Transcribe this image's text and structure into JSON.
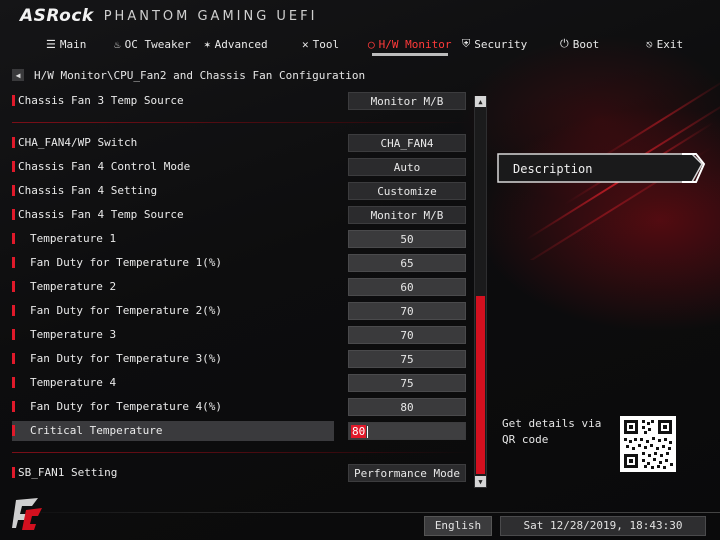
{
  "brand": {
    "name": "ASRock",
    "product": "PHANTOM GAMING UEFI"
  },
  "nav": [
    {
      "label": "Main",
      "icon": "list-icon",
      "glyph": "☰",
      "active": false
    },
    {
      "label": "OC Tweaker",
      "icon": "flame-icon",
      "glyph": "♨",
      "active": false
    },
    {
      "label": "Advanced",
      "icon": "star-tool-icon",
      "glyph": "✶",
      "active": false
    },
    {
      "label": "Tool",
      "icon": "tools-icon",
      "glyph": "✕",
      "active": false
    },
    {
      "label": "H/W Monitor",
      "icon": "monitor-icon",
      "glyph": "◯",
      "active": true
    },
    {
      "label": "Security",
      "icon": "shield-icon",
      "glyph": "⛨",
      "active": false
    },
    {
      "label": "Boot",
      "icon": "power-icon",
      "glyph": "⏻",
      "active": false
    },
    {
      "label": "Exit",
      "icon": "exit-icon",
      "glyph": "⎋",
      "active": false
    }
  ],
  "breadcrumb": "H/W Monitor\\CPU_Fan2 and Chassis Fan Configuration",
  "settings": {
    "chassis_fan3_temp_source": {
      "label": "Chassis Fan 3 Temp Source",
      "value": "Monitor M/B"
    },
    "cha_fan4_wp_switch": {
      "label": "CHA_FAN4/WP Switch",
      "value": "CHA_FAN4"
    },
    "chassis_fan4_control_mode": {
      "label": "Chassis Fan 4 Control Mode",
      "value": "Auto"
    },
    "chassis_fan4_setting": {
      "label": "Chassis Fan 4 Setting",
      "value": "Customize"
    },
    "chassis_fan4_temp_source": {
      "label": "Chassis Fan 4 Temp Source",
      "value": "Monitor M/B"
    },
    "temperature_1": {
      "label": "Temperature 1",
      "value": "50"
    },
    "fan_duty_1": {
      "label": "Fan Duty for Temperature 1(%)",
      "value": "65"
    },
    "temperature_2": {
      "label": "Temperature 2",
      "value": "60"
    },
    "fan_duty_2": {
      "label": "Fan Duty for Temperature 2(%)",
      "value": "70"
    },
    "temperature_3": {
      "label": "Temperature 3",
      "value": "70"
    },
    "fan_duty_3": {
      "label": "Fan Duty for Temperature 3(%)",
      "value": "75"
    },
    "temperature_4": {
      "label": "Temperature 4",
      "value": "75"
    },
    "fan_duty_4": {
      "label": "Fan Duty for Temperature 4(%)",
      "value": "80"
    },
    "critical_temperature": {
      "label": "Critical Temperature",
      "value": "80"
    },
    "sb_fan1_setting": {
      "label": "SB_FAN1 Setting",
      "value": "Performance Mode"
    }
  },
  "description": {
    "title": "Description"
  },
  "qr": {
    "text": "Get details via QR code"
  },
  "footer": {
    "language": "English",
    "datetime": "Sat 12/28/2019, 18:43:30"
  },
  "colors": {
    "accent": "#e0192a",
    "active_nav": "#ff3a3a",
    "background": "#0b0b0c"
  }
}
